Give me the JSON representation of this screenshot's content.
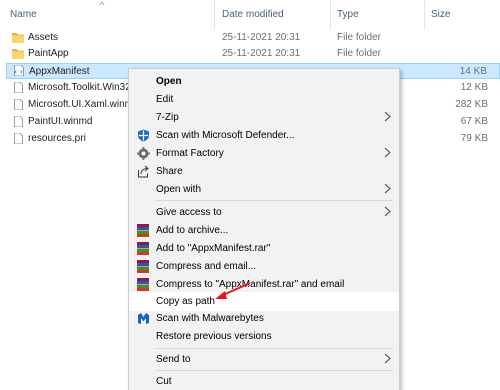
{
  "columns": {
    "name": "Name",
    "date": "Date modified",
    "type": "Type",
    "size": "Size"
  },
  "files": [
    {
      "name": "Assets",
      "date": "25-11-2021 20:31",
      "type": "File folder",
      "size": "",
      "icon": "folder-icon"
    },
    {
      "name": "PaintApp",
      "date": "25-11-2021 20:31",
      "type": "File folder",
      "size": "",
      "icon": "folder-icon"
    },
    {
      "name": "AppxManifest",
      "date": "",
      "type": "",
      "size": "14 KB",
      "icon": "xml-file-icon",
      "selected": true
    },
    {
      "name": "Microsoft.Toolkit.Win32",
      "date": "",
      "type": "",
      "size": "12 KB",
      "icon": "file-icon"
    },
    {
      "name": "Microsoft.UI.Xaml.winm",
      "date": "",
      "type": "",
      "size": "282 KB",
      "icon": "file-icon"
    },
    {
      "name": "PaintUI.winmd",
      "date": "",
      "type": "",
      "size": "67 KB",
      "icon": "file-icon"
    },
    {
      "name": "resources.pri",
      "date": "",
      "type": "",
      "size": "79 KB",
      "icon": "file-icon"
    }
  ],
  "context_menu": {
    "open": "Open",
    "edit": "Edit",
    "zip": "7-Zip",
    "defender": "Scan with Microsoft Defender...",
    "format_factory": "Format Factory",
    "share": "Share",
    "open_with": "Open with",
    "give_access": "Give access to",
    "add_archive": "Add to archive...",
    "add_rar": "Add to \"AppxManifest.rar\"",
    "compress_email": "Compress and email...",
    "compress_rar_email": "Compress to \"AppxManifest.rar\" and email",
    "copy_path": "Copy as path",
    "malwarebytes": "Scan with Malwarebytes",
    "restore": "Restore previous versions",
    "send_to": "Send to",
    "cut": "Cut"
  },
  "colors": {
    "selection": "#cce8ff",
    "menu_bg": "#f2f2f2",
    "annotation_arrow": "#e8141b"
  }
}
